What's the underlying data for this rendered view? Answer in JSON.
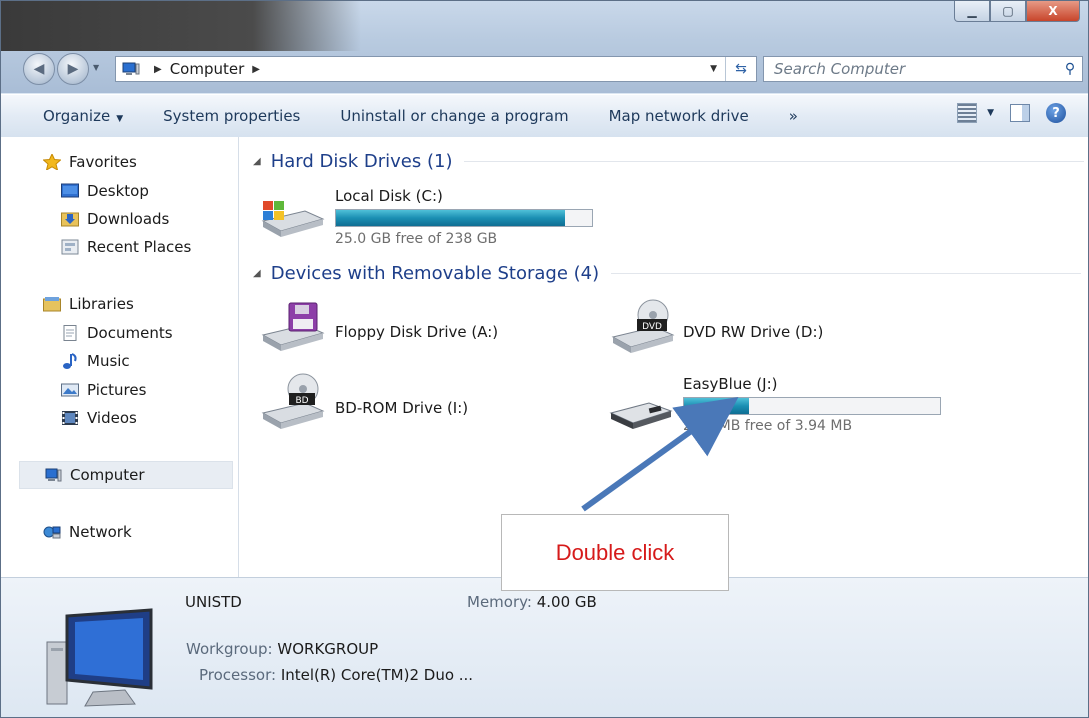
{
  "window": {
    "controls": {
      "minimize": "▁",
      "maximize": "▢",
      "close": "X"
    }
  },
  "address": {
    "location": "Computer",
    "search_placeholder": "Search Computer"
  },
  "commandbar": {
    "items": [
      "Organize",
      "System properties",
      "Uninstall or change a program",
      "Map network drive",
      "»"
    ]
  },
  "navpane": {
    "favorites": "Favorites",
    "desktop": "Desktop",
    "downloads": "Downloads",
    "recent": "Recent Places",
    "libraries": "Libraries",
    "documents": "Documents",
    "music": "Music",
    "pictures": "Pictures",
    "videos": "Videos",
    "computer": "Computer",
    "network": "Network"
  },
  "content": {
    "hdd_group": "Hard Disk Drives (1)",
    "removable_group": "Devices with Removable Storage (4)",
    "drives": {
      "c": {
        "label": "Local Disk (C:)",
        "free": "25.0 GB free of 238 GB",
        "used_fraction": 0.895
      },
      "a": {
        "label": "Floppy Disk Drive (A:)"
      },
      "d": {
        "label": "DVD RW Drive (D:)",
        "badge": "DVD"
      },
      "i": {
        "label": "BD-ROM Drive (I:)",
        "badge": "BD"
      },
      "j": {
        "label": "EasyBlue (J:)",
        "free": "2.94 MB free of 3.94 MB",
        "used_fraction": 0.254
      }
    }
  },
  "details": {
    "name": "UNISTD",
    "memory_label": "Memory:",
    "memory_value": "4.00 GB",
    "workgroup_label": "Workgroup:",
    "workgroup_value": "WORKGROUP",
    "processor_label": "Processor:",
    "processor_value": "Intel(R) Core(TM)2 Duo ..."
  },
  "annotation": {
    "text": "Double click",
    "color": "#d61a1a",
    "arrow_color": "#4a78b8"
  }
}
